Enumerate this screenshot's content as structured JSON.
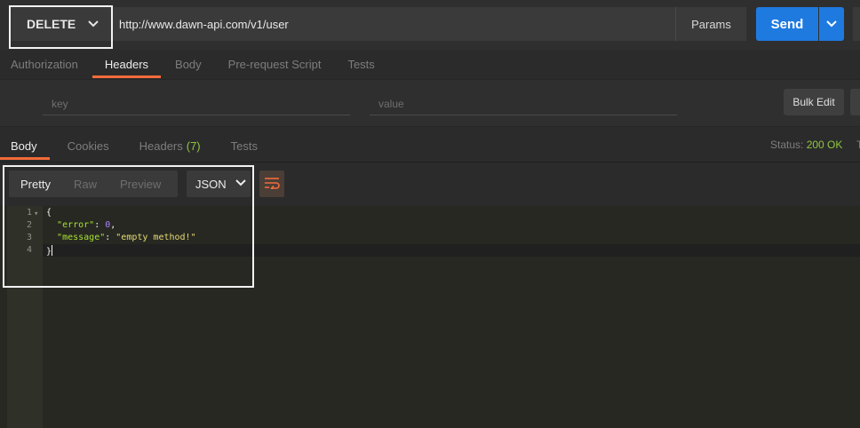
{
  "request": {
    "method": "DELETE",
    "url": "http://www.dawn-api.com/v1/user",
    "params_label": "Params",
    "send_label": "Send"
  },
  "request_tabs": [
    "Authorization",
    "Headers",
    "Body",
    "Pre-request Script",
    "Tests"
  ],
  "request_active_tab": "Headers",
  "headers_editor": {
    "key_placeholder": "key",
    "value_placeholder": "value",
    "bulk_edit_label": "Bulk Edit"
  },
  "response_tabs": {
    "body": "Body",
    "cookies": "Cookies",
    "headers": "Headers",
    "headers_count": "(7)",
    "tests": "Tests"
  },
  "status": {
    "label": "Status:",
    "value": "200 OK"
  },
  "view_modes": [
    "Pretty",
    "Raw",
    "Preview"
  ],
  "active_view_mode": "Pretty",
  "format": "JSON",
  "code": {
    "line_numbers": [
      "1",
      "2",
      "3",
      "4"
    ],
    "open_brace": "{",
    "key1": "\"error\"",
    "val1": "0",
    "key2": "\"message\"",
    "val2": "\"empty method!\"",
    "close_brace": "}"
  },
  "colors": {
    "accent": "#f26b3a",
    "send": "#1f7ae0",
    "ok": "#8ec640"
  }
}
